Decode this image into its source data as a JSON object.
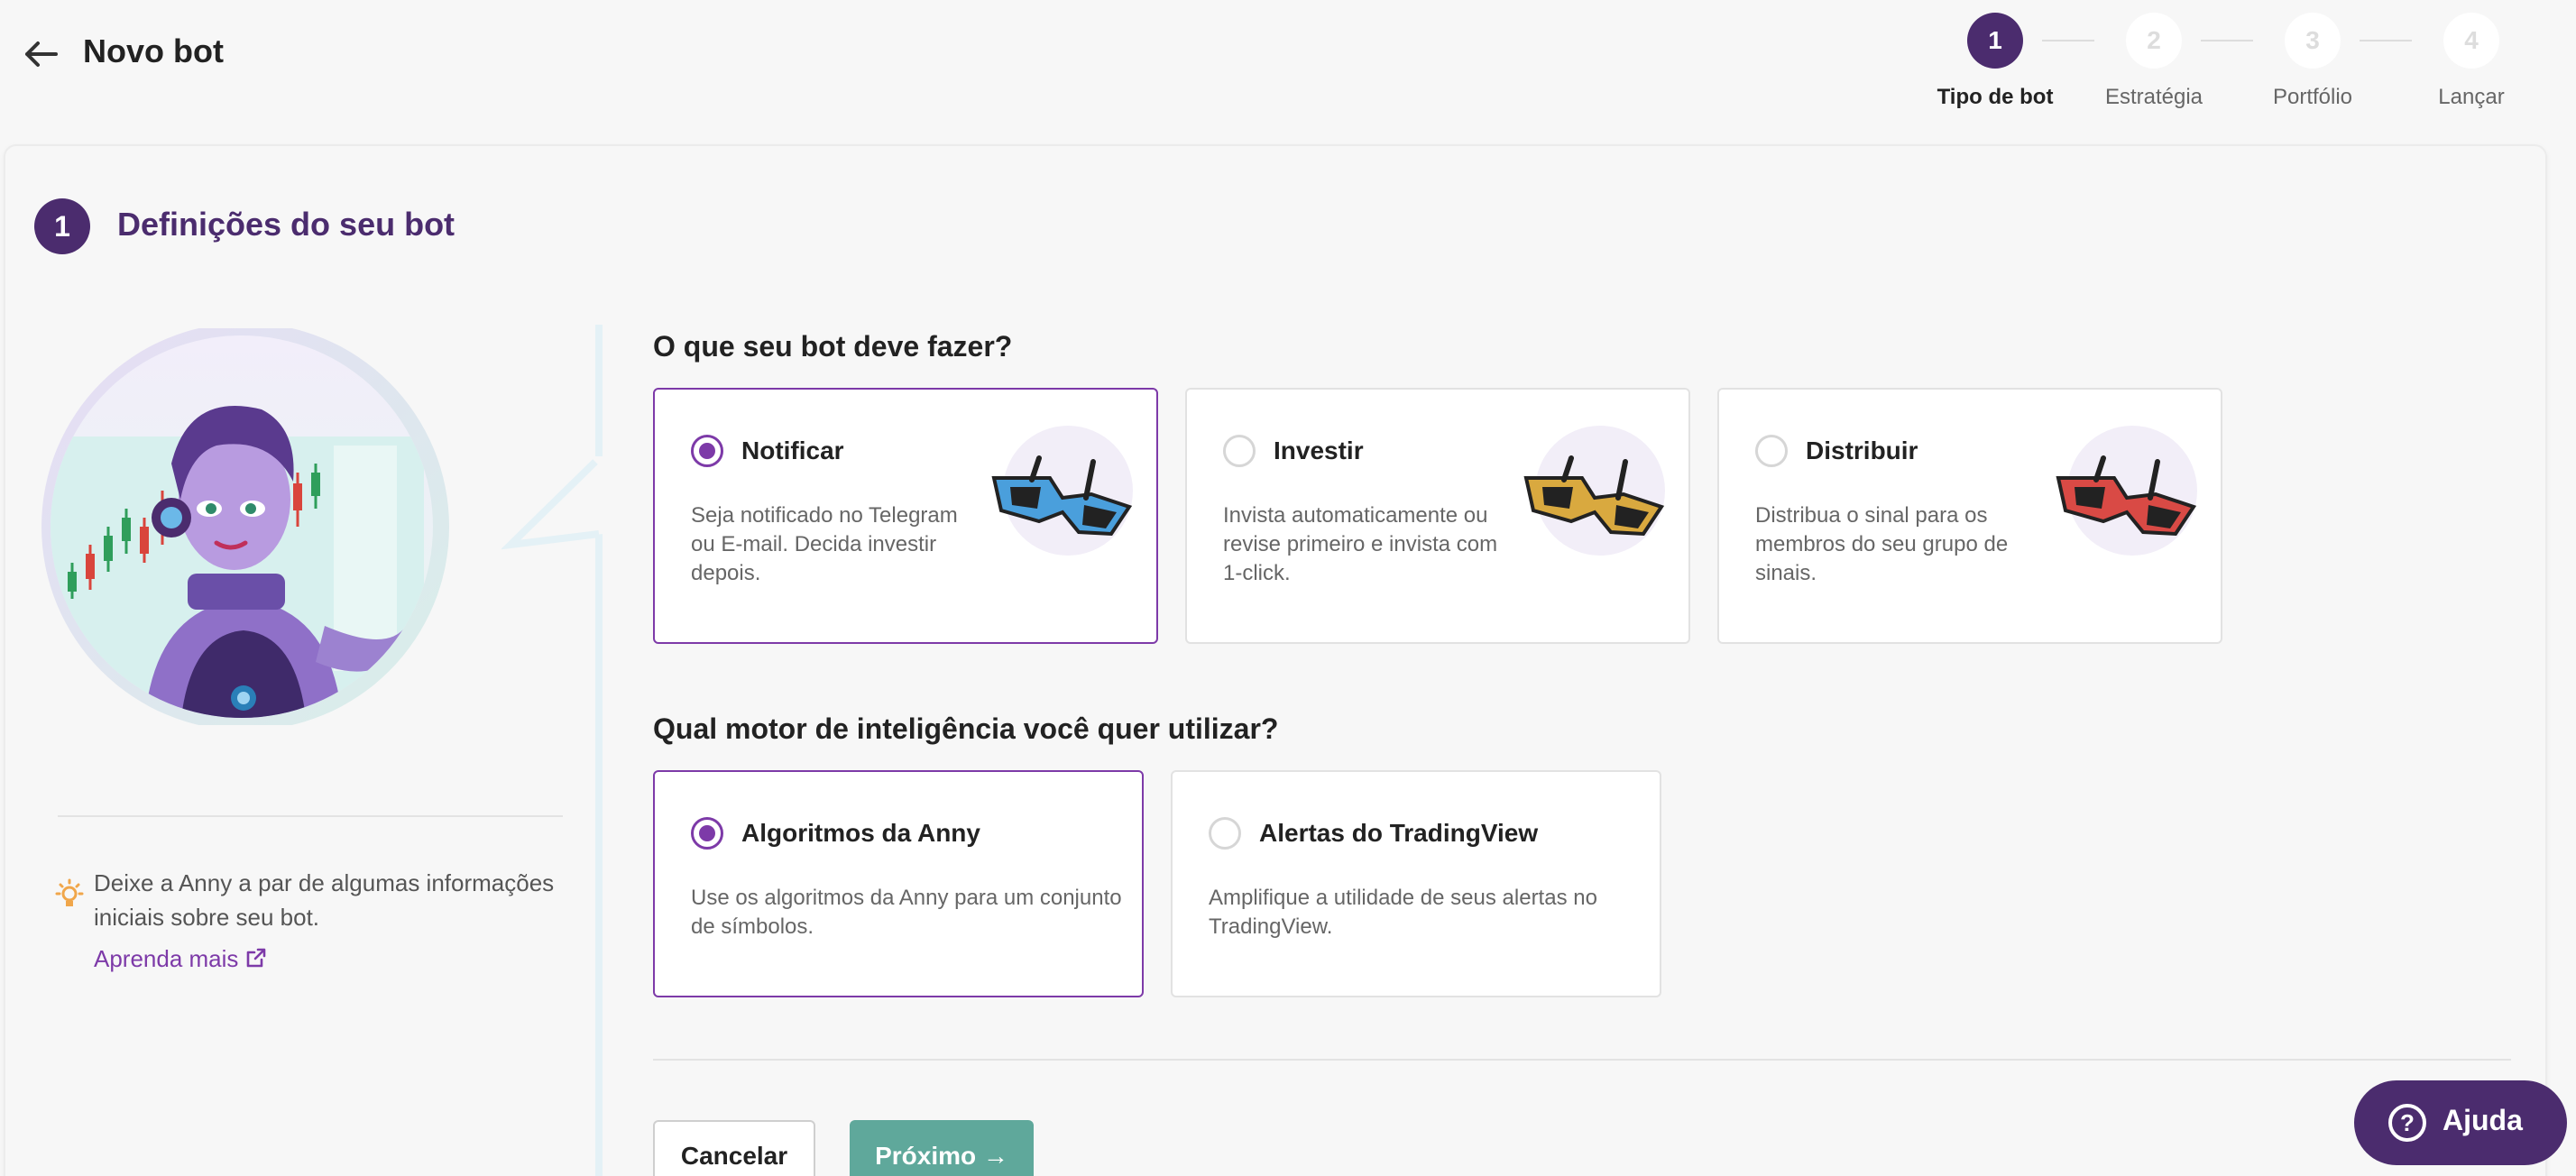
{
  "header": {
    "title": "Novo bot",
    "steps": [
      {
        "num": "1",
        "label": "Tipo de bot"
      },
      {
        "num": "2",
        "label": "Estratégia"
      },
      {
        "num": "3",
        "label": "Portfólio"
      },
      {
        "num": "4",
        "label": "Lançar"
      }
    ]
  },
  "section": {
    "num": "1",
    "title": "Definições do seu bot"
  },
  "sidebar": {
    "tip": "Deixe a Anny a par de algumas informações iniciais sobre seu bot.",
    "learn_more": "Aprenda mais"
  },
  "question1": {
    "title": "O que seu bot deve fazer?",
    "options": [
      {
        "title": "Notificar",
        "desc": "Seja notificado no Telegram ou E-mail. Decida investir depois.",
        "selected": true
      },
      {
        "title": "Investir",
        "desc": "Invista automaticamente ou revise primeiro e invista com 1-click.",
        "selected": false
      },
      {
        "title": "Distribuir",
        "desc": "Distribua o sinal para os membros do seu grupo de sinais.",
        "selected": false
      }
    ]
  },
  "question2": {
    "title": "Qual motor de inteligência você quer utilizar?",
    "options": [
      {
        "title": "Algoritmos da Anny",
        "desc": "Use os algoritmos da Anny para um conjunto de símbolos.",
        "selected": true
      },
      {
        "title": "Alertas do TradingView",
        "desc": "Amplifique a utilidade de seus alertas no TradingView.",
        "selected": false
      }
    ]
  },
  "actions": {
    "cancel": "Cancelar",
    "next": "Próximo →"
  },
  "help": {
    "label": "Ajuda",
    "icon_glyph": "?"
  },
  "colors": {
    "brand_purple": "#4b2c6e",
    "accent_purple": "#7d3aa8",
    "next_green": "#5fa89b",
    "glasses_blue": "#4a9fdc",
    "glasses_gold": "#d9a93f",
    "glasses_red": "#d94a45"
  }
}
